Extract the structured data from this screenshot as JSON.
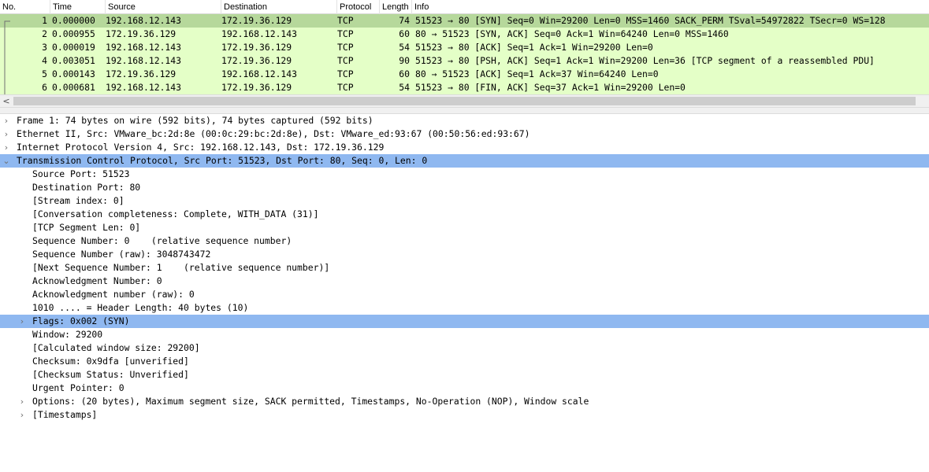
{
  "packet_list": {
    "columns": [
      "No.",
      "Time",
      "Source",
      "Destination",
      "Protocol",
      "Length",
      "Info"
    ],
    "rows": [
      {
        "no": "1",
        "time": "0.000000",
        "source": "192.168.12.143",
        "destination": "172.19.36.129",
        "protocol": "TCP",
        "length": "74",
        "info": "51523 → 80 [SYN] Seq=0 Win=29200 Len=0 MSS=1460 SACK_PERM TSval=54972822 TSecr=0 WS=128"
      },
      {
        "no": "2",
        "time": "0.000955",
        "source": "172.19.36.129",
        "destination": "192.168.12.143",
        "protocol": "TCP",
        "length": "60",
        "info": "80 → 51523 [SYN, ACK] Seq=0 Ack=1 Win=64240 Len=0 MSS=1460"
      },
      {
        "no": "3",
        "time": "0.000019",
        "source": "192.168.12.143",
        "destination": "172.19.36.129",
        "protocol": "TCP",
        "length": "54",
        "info": "51523 → 80 [ACK] Seq=1 Ack=1 Win=29200 Len=0"
      },
      {
        "no": "4",
        "time": "0.003051",
        "source": "192.168.12.143",
        "destination": "172.19.36.129",
        "protocol": "TCP",
        "length": "90",
        "info": "51523 → 80 [PSH, ACK] Seq=1 Ack=1 Win=29200 Len=36 [TCP segment of a reassembled PDU]"
      },
      {
        "no": "5",
        "time": "0.000143",
        "source": "172.19.36.129",
        "destination": "192.168.12.143",
        "protocol": "TCP",
        "length": "60",
        "info": "80 → 51523 [ACK] Seq=1 Ack=37 Win=64240 Len=0"
      },
      {
        "no": "6",
        "time": "0.000681",
        "source": "192.168.12.143",
        "destination": "172.19.36.129",
        "protocol": "TCP",
        "length": "54",
        "info": "51523 → 80 [FIN, ACK] Seq=37 Ack=1 Win=29200 Len=0"
      }
    ]
  },
  "scrollbar": {
    "left_arrow": "<"
  },
  "details": {
    "items": [
      {
        "text": "Frame 1: 74 bytes on wire (592 bits), 74 bytes captured (592 bits)",
        "toggle": "collapsed"
      },
      {
        "text": "Ethernet II, Src: VMware_bc:2d:8e (00:0c:29:bc:2d:8e), Dst: VMware_ed:93:67 (00:50:56:ed:93:67)",
        "toggle": "collapsed"
      },
      {
        "text": "Internet Protocol Version 4, Src: 192.168.12.143, Dst: 172.19.36.129",
        "toggle": "collapsed"
      },
      {
        "text": "Transmission Control Protocol, Src Port: 51523, Dst Port: 80, Seq: 0, Len: 0",
        "toggle": "expanded"
      },
      {
        "text": "Source Port: 51523",
        "toggle": "none"
      },
      {
        "text": "Destination Port: 80",
        "toggle": "none"
      },
      {
        "text": "[Stream index: 0]",
        "toggle": "none"
      },
      {
        "text": "[Conversation completeness: Complete, WITH_DATA (31)]",
        "toggle": "none"
      },
      {
        "text": "[TCP Segment Len: 0]",
        "toggle": "none"
      },
      {
        "text": "Sequence Number: 0    (relative sequence number)",
        "toggle": "none"
      },
      {
        "text": "Sequence Number (raw): 3048743472",
        "toggle": "none"
      },
      {
        "text": "[Next Sequence Number: 1    (relative sequence number)]",
        "toggle": "none"
      },
      {
        "text": "Acknowledgment Number: 0",
        "toggle": "none"
      },
      {
        "text": "Acknowledgment number (raw): 0",
        "toggle": "none"
      },
      {
        "text": "1010 .... = Header Length: 40 bytes (10)",
        "toggle": "none"
      },
      {
        "text": "Flags: 0x002 (SYN)",
        "toggle": "collapsed"
      },
      {
        "text": "Window: 29200",
        "toggle": "none"
      },
      {
        "text": "[Calculated window size: 29200]",
        "toggle": "none"
      },
      {
        "text": "Checksum: 0x9dfa [unverified]",
        "toggle": "none"
      },
      {
        "text": "[Checksum Status: Unverified]",
        "toggle": "none"
      },
      {
        "text": "Urgent Pointer: 0",
        "toggle": "none"
      },
      {
        "text": "Options: (20 bytes), Maximum segment size, SACK permitted, Timestamps, No-Operation (NOP), Window scale",
        "toggle": "collapsed"
      },
      {
        "text": "[Timestamps]",
        "toggle": "collapsed"
      }
    ]
  },
  "colors": {
    "tcp_row": "#e4ffc7",
    "selected_packet": "#b6d89b",
    "selected_tree": "#8fb8f0"
  }
}
